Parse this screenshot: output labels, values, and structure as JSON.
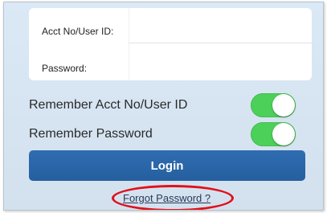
{
  "login_form": {
    "acct_label": "Acct No/User ID:",
    "acct_value": "",
    "password_label": "Password:",
    "password_value": ""
  },
  "toggles": [
    {
      "label": "Remember Acct No/User ID",
      "state": "on"
    },
    {
      "label": "Remember Password",
      "state": "on"
    }
  ],
  "login_button_label": "Login",
  "forgot_password_label": "Forgot Password ?",
  "colors": {
    "background": "#d6e4f2",
    "toggle_on": "#4cd05a",
    "button": "#2a66a8",
    "highlight": "#e0101a"
  }
}
